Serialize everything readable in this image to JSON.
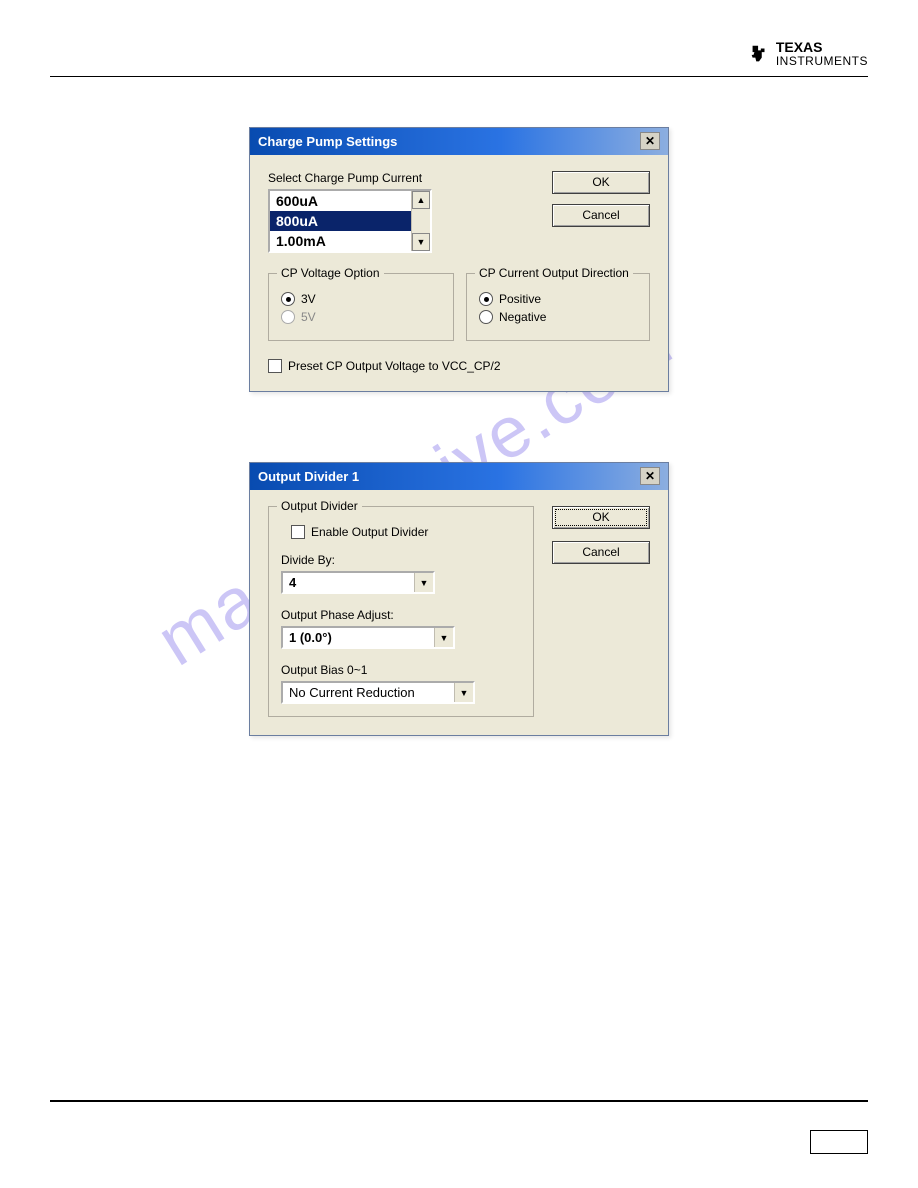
{
  "header": {
    "brand_top": "TEXAS",
    "brand_bottom": "INSTRUMENTS"
  },
  "watermark": "manualshive.com",
  "dialog1": {
    "title": "Charge Pump Settings",
    "list_label": "Select Charge Pump Current",
    "list_items": [
      "600uA",
      "800uA",
      "1.00mA"
    ],
    "ok": "OK",
    "cancel": "Cancel",
    "group_voltage": {
      "legend": "CP Voltage Option",
      "opt1": "3V",
      "opt2": "5V"
    },
    "group_direction": {
      "legend": "CP Current Output Direction",
      "opt1": "Positive",
      "opt2": "Negative"
    },
    "preset_label": "Preset CP Output Voltage to VCC_CP/2"
  },
  "dialog2": {
    "title": "Output Divider 1",
    "ok": "OK",
    "cancel": "Cancel",
    "group_legend": "Output Divider",
    "enable_label": "Enable Output Divider",
    "divide_label": "Divide By:",
    "divide_value": "4",
    "phase_label": "Output Phase Adjust:",
    "phase_value": "1 (0.0°)",
    "bias_label": "Output Bias 0~1",
    "bias_value": "No Current Reduction"
  }
}
